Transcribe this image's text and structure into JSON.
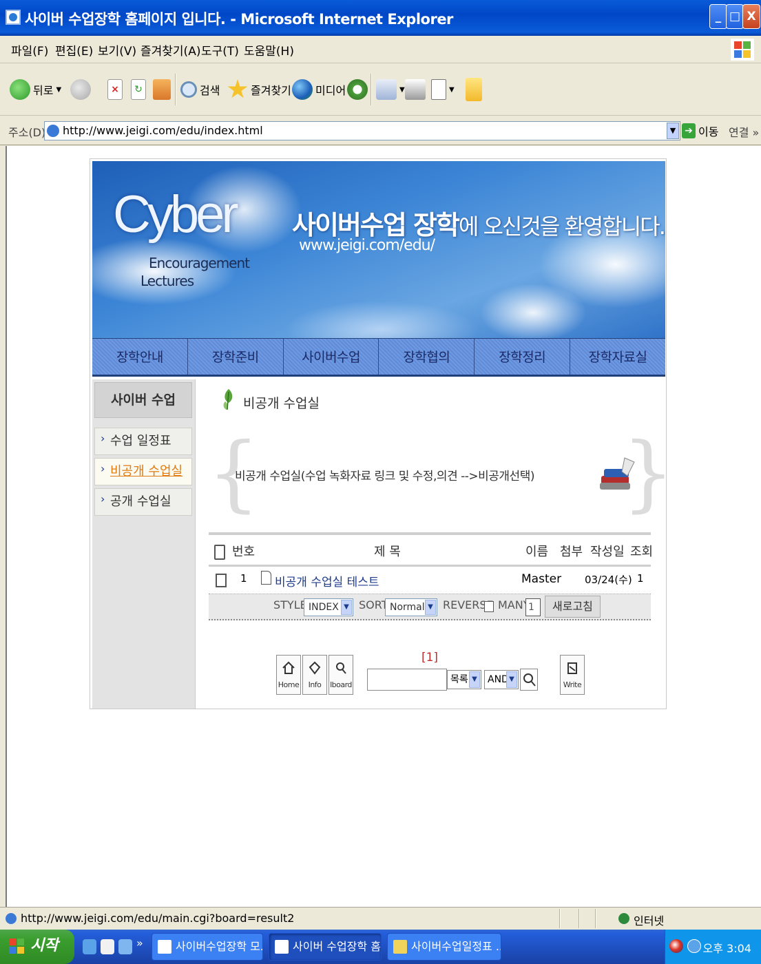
{
  "window": {
    "title": "사이버 수업장학 홈페이지 입니다. - Microsoft Internet Explorer",
    "buttons": {
      "minimize": "_",
      "maximize": "□",
      "close": "X"
    }
  },
  "menubar": [
    "파일(F)",
    "편집(E)",
    "보기(V)",
    "즐겨찾기(A)",
    "도구(T)",
    "도움말(H)"
  ],
  "toolbar": {
    "back": "뒤로",
    "search": "검색",
    "favorites": "즐겨찾기",
    "media": "미디어"
  },
  "address": {
    "label": "주소(D)",
    "url": "http://www.jeigi.com/edu/index.html",
    "go": "이동",
    "links": "연결 »"
  },
  "banner": {
    "logo": "Cyber",
    "logo_sub1": "Encouragement",
    "logo_sub2": "Lectures",
    "welcome_bold": "사이버수업 장학",
    "welcome_rest": "에 오신것을 환영합니다.",
    "site_url": "www.jeigi.com/edu/"
  },
  "topnav": [
    "장학안내",
    "장학준비",
    "사이버수업",
    "장학협의",
    "장학정리",
    "장학자료실"
  ],
  "sidebar": {
    "heading": "사이버 수업",
    "items": [
      {
        "label": "수업 일정표"
      },
      {
        "label": "비공개 수업실"
      },
      {
        "label": "공개 수업실"
      }
    ]
  },
  "content": {
    "section_title": "비공개 수업실",
    "notice": "비공개 수업실(수업 녹화자료 링크 및 수정,의견 -->비공개선택)"
  },
  "board": {
    "columns": {
      "no": "번호",
      "title": "제 목",
      "name": "이름",
      "attach": "첨부",
      "date": "작성일",
      "views": "조회"
    },
    "rows": [
      {
        "no": "1",
        "title": "비공개 수업실 테스트",
        "name": "Master",
        "date": "03/24(수)",
        "views": "1"
      }
    ],
    "options": {
      "style_label": "STYLE",
      "style_value": "INDEX",
      "sort_label": "SORT",
      "sort_value": "Normal",
      "reverse_label": "REVERSE",
      "many_label": "MANY",
      "many_value": "1",
      "refresh": "새로고침"
    },
    "pager": "[1]"
  },
  "tools": {
    "home": "Home",
    "info": "Info",
    "board": "lboard",
    "search_field": "목록",
    "search_op": "AND",
    "write": "Write"
  },
  "status": {
    "url": "http://www.jeigi.com/edu/main.cgi?board=result2",
    "zone": "인터넷"
  },
  "taskbar": {
    "start": "시작",
    "tasks": [
      "사이버수업장학 모...",
      "사이버 수업장학 홈...",
      "사이버수업일정표 ..."
    ],
    "clock": "오후 3:04"
  },
  "colors": {
    "title_bar": "#0a5bd8",
    "nav_bar": "#6f99e0",
    "active_link": "#e07a10",
    "pager": "#c62b2b",
    "start_button": "#3a9d2e"
  }
}
